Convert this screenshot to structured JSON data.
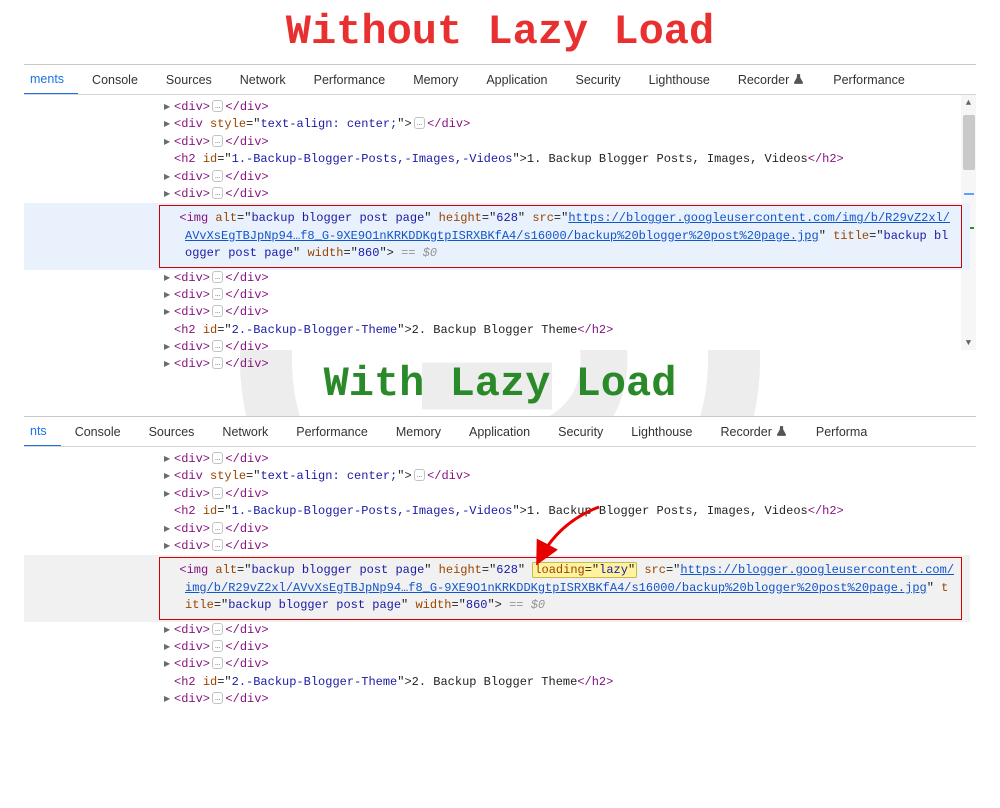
{
  "titles": {
    "without": "Without Lazy Load",
    "with": "With Lazy Load"
  },
  "devtools_tabs": [
    "Elements",
    "Console",
    "Sources",
    "Network",
    "Performance",
    "Memory",
    "Application",
    "Security",
    "Lighthouse",
    "Recorder",
    "Performance"
  ],
  "devtools_tabs2": [
    "Elements",
    "Console",
    "Sources",
    "Network",
    "Performance",
    "Memory",
    "Application",
    "Security",
    "Lighthouse",
    "Recorder",
    "Performa"
  ],
  "active_tab_fragment_1": "ments",
  "active_tab_fragment_2": "nts",
  "code": {
    "div_open": "<div>",
    "div_close": "</div>",
    "div_style_open": "<div ",
    "style_attr_name": "style",
    "style_attr_val": "text-align: center;",
    "h2_open": "<h2 ",
    "id_attr": "id",
    "h2a_idval": "1.-Backup-Blogger-Posts,-Images,-Videos",
    "h2a_text": "1. Backup Blogger Posts, Images, Videos",
    "h2b_idval": "2.-Backup-Blogger-Theme",
    "h2b_text": "2. Backup Blogger Theme",
    "h2_close": "</h2>",
    "img_tag": "<img ",
    "alt_name": "alt",
    "alt_val": "backup blogger post page",
    "height_name": "height",
    "height_val": "628",
    "loading_name": "loading",
    "loading_val": "lazy",
    "src_name": "src",
    "src_url_top": "https://blogger.googleusercontent.com/img/b/R29vZ2xl/AVvXsEgTBJpNp94…f8_G-9XE9O1nKRKDDKgtpISRXBKfA4/s16000/backup%20blogger%20post%20page.jpg",
    "src_url_bot": "https://blogger.googleusercontent.com/img/b/R29vZ2xl/AVvXsEgTBJpNp94…f8_G-9XE9O1nKRKDDKgtpISRXBKfA4/s16000/backup%20blogger%20post%20page.jpg",
    "title_name": "title",
    "title_val": "backup blogger post page",
    "width_name": "width",
    "width_val": "860",
    "eq0": "== $0"
  }
}
